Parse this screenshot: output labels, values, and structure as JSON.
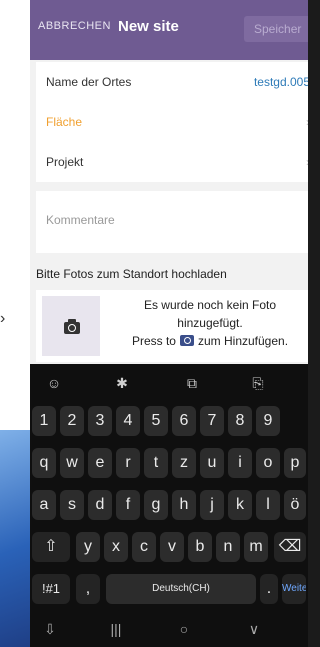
{
  "appbar": {
    "cancel": "ABBRECHEN",
    "title": "New site",
    "save": "Speicher"
  },
  "fields": {
    "name_label": "Name der Ortes",
    "name_value": "testgd.005",
    "area_label": "Fläche",
    "project_label": "Projekt",
    "chevron": "›"
  },
  "comment": {
    "placeholder": "Kommentare"
  },
  "photos": {
    "section_label": "Bitte Fotos zum Standort hochladen",
    "empty_line1": "Es wurde noch kein Foto",
    "empty_line2": "hinzugefügt.",
    "hint_prefix": "Press to",
    "hint_suffix": "zum Hinzufügen."
  },
  "keyboard": {
    "toolbar": [
      "☺",
      "✱",
      "⧉",
      "⎘"
    ],
    "row_numbers": [
      "1",
      "2",
      "3",
      "4",
      "5",
      "6",
      "7",
      "8",
      "9"
    ],
    "row1": [
      "q",
      "w",
      "e",
      "r",
      "t",
      "z",
      "u",
      "i",
      "o",
      "p"
    ],
    "row2": [
      "a",
      "s",
      "d",
      "f",
      "g",
      "h",
      "j",
      "k",
      "l",
      "ö"
    ],
    "row3": [
      "y",
      "x",
      "c",
      "v",
      "b",
      "n",
      "m"
    ],
    "shift": "⇧",
    "backspace": "⌫",
    "symbols": "!#1",
    "comma": ",",
    "space": "Deutsch(CH)",
    "period": ".",
    "enter": "Weiter",
    "nav": [
      "⇩",
      "|||",
      "○",
      "∨"
    ]
  },
  "colors": {
    "appbar": "#6f5b92",
    "accent_link": "#2e7bb8",
    "area_label": "#f0a030"
  }
}
